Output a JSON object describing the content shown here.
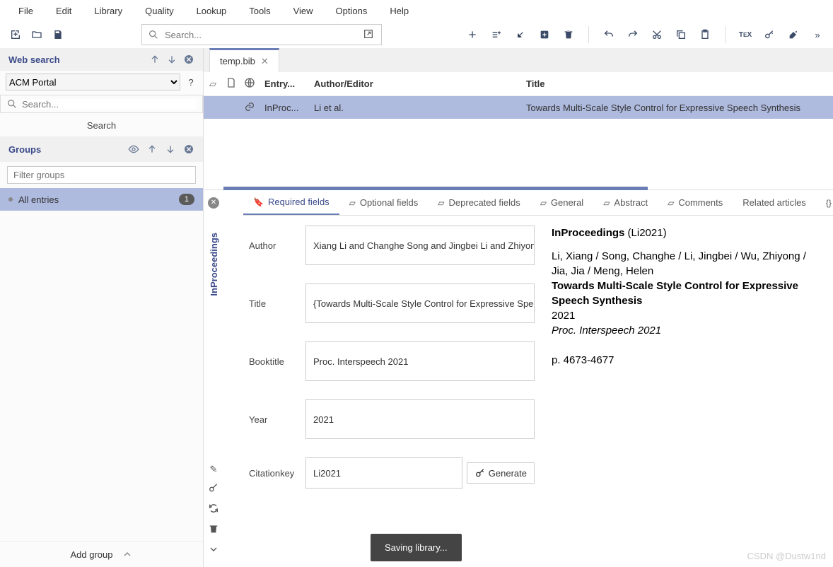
{
  "menu": [
    "File",
    "Edit",
    "Library",
    "Quality",
    "Lookup",
    "Tools",
    "View",
    "Options",
    "Help"
  ],
  "search": {
    "placeholder": "Search..."
  },
  "sidebar": {
    "websearch_title": "Web search",
    "source": "ACM Portal",
    "search_placeholder": "Search...",
    "search_btn": "Search",
    "groups_title": "Groups",
    "filter_placeholder": "Filter groups",
    "all_entries": "All entries",
    "all_count": "1",
    "add_group": "Add group"
  },
  "file_tab": "temp.bib",
  "cols": {
    "entrytype": "Entry...",
    "author": "Author/Editor",
    "title": "Title"
  },
  "entry": {
    "type": "InProc...",
    "author": "Li et al.",
    "title": "Towards Multi-Scale Style Control for Expressive Speech Synthesis"
  },
  "vert_label": "InProceedings",
  "ed_tabs": {
    "required": "Required fields",
    "optional": "Optional fields",
    "deprecated": "Deprecated fields",
    "general": "General",
    "abstract": "Abstract",
    "comments": "Comments",
    "related": "Related articles",
    "bibtex": "BibTeX"
  },
  "fields": {
    "author_label": "Author",
    "author_val": "Xiang Li and Changhe Song and Jingbei Li and Zhiyong",
    "title_label": "Title",
    "title_val": "{Towards Multi-Scale Style Control for Expressive Speec",
    "booktitle_label": "Booktitle",
    "booktitle_val": "Proc. Interspeech 2021",
    "year_label": "Year",
    "year_val": "2021",
    "citkey_label": "Citationkey",
    "citkey_val": "Li2021",
    "generate_btn": "Generate"
  },
  "preview": {
    "type": "InProceedings",
    "key": "(Li2021)",
    "authors": "Li, Xiang / Song, Changhe / Li, Jingbei / Wu, Zhiyong / Jia, Jia / Meng, Helen",
    "title": "Towards Multi-Scale Style Control for Expressive Speech Synthesis",
    "year": "2021",
    "venue": "Proc. Interspeech 2021",
    "pages": "p. 4673-4677"
  },
  "toast": "Saving library...",
  "watermark": "CSDN @Dustw1nd"
}
